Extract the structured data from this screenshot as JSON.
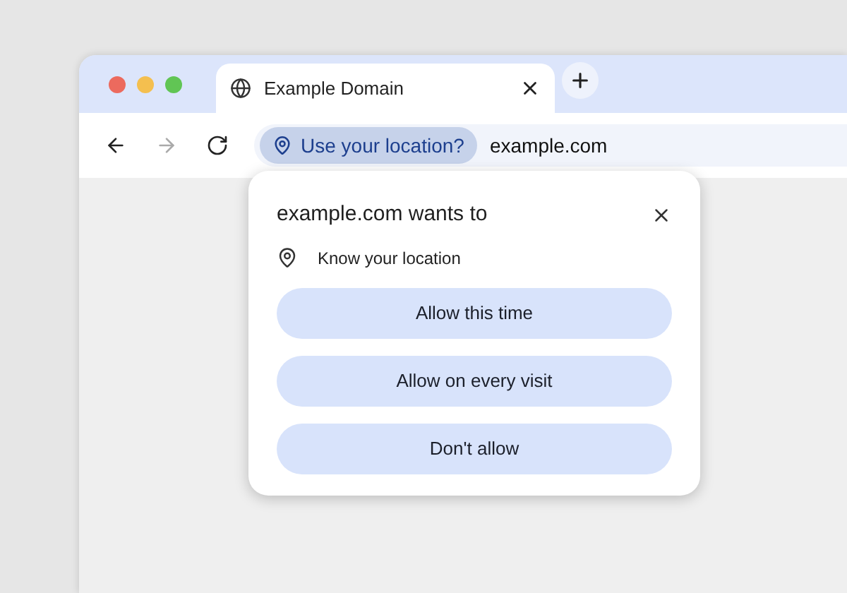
{
  "tab": {
    "title": "Example Domain",
    "selected": true
  },
  "nav": [
    {
      "kind": "back",
      "disabled": false
    },
    {
      "kind": "forward",
      "disabled": true
    },
    {
      "kind": "reload",
      "disabled": false
    }
  ],
  "location_chip": {
    "label": "Use your location?"
  },
  "address": {
    "url": "example.com"
  },
  "popup": {
    "title": "example.com wants to",
    "permission": "Know your location",
    "buttons": [
      "Allow this time",
      "Allow on every visit",
      "Don't allow"
    ]
  }
}
